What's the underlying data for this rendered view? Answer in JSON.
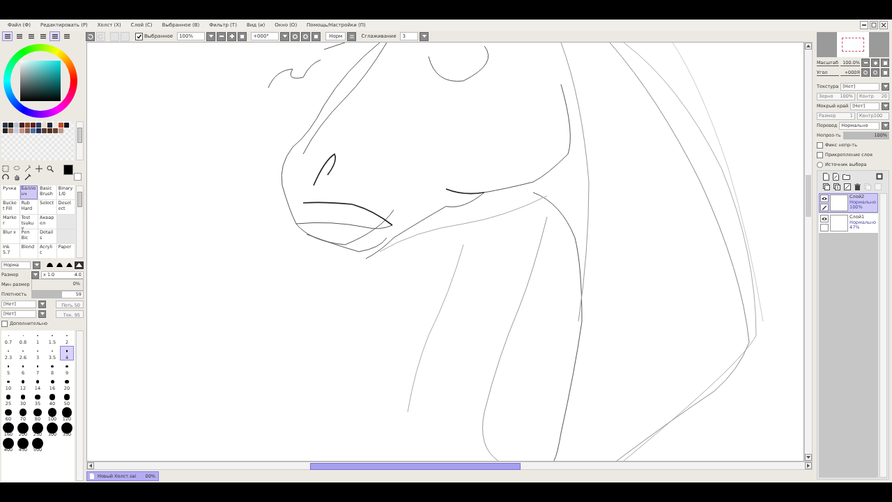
{
  "menu": [
    "Файл (Ф)",
    "Редактировать (Р)",
    "Холст (Х)",
    "Слой (С)",
    "Выбранное (В)",
    "Фильтр (Т)",
    "Вид (и)",
    "Окно (О)",
    "Помощь/Настройки (П)"
  ],
  "panel_toggles": [
    {
      "selected": true
    },
    {
      "selected": false
    },
    {
      "selected": false
    },
    {
      "selected": false
    },
    {
      "selected": true
    },
    {
      "selected": false
    }
  ],
  "toolbar": {
    "selection": {
      "label": "Выбранное",
      "checked": true
    },
    "zoom": "100%",
    "angle": "+000°",
    "mode_button": "Норм",
    "smoothing_label": "Сглаживание",
    "smoothing": "3"
  },
  "palette": [
    {
      "color": "#2a3440"
    },
    {
      "color": "#1c1a1c"
    },
    {
      "color": "#b8c2cc"
    },
    {
      "color": "#4a1c1c"
    },
    {
      "color": "#8a4020"
    },
    {
      "color": "#5a1c1c"
    },
    {
      "color": "#223a66"
    },
    {
      "color": "#f2dcc8"
    },
    {
      "color": "#1c2638"
    },
    {
      "color": "#f2e6dc"
    },
    {
      "color": "#c04a2a"
    },
    {
      "color": "#14141c"
    },
    {
      "color": "#2a2020"
    },
    {
      "color": "#a08070"
    },
    {
      "color": "#c8d0e0"
    },
    {
      "color": "#c09080"
    },
    {
      "color": "#8a6050"
    },
    {
      "color": "#4a6a9a"
    },
    {
      "color": "#1c2e5a"
    },
    {
      "color": "#5a3a2a"
    },
    {
      "color": "#4a3020"
    },
    {
      "color": "#6a4030"
    },
    {
      "color": "#c09888"
    }
  ],
  "tools": [
    {
      "label": "Ручка",
      "selected": false,
      "kind": "tool"
    },
    {
      "label": "Баллонч",
      "selected": true,
      "kind": "tool"
    },
    {
      "label": "Basic Brush",
      "selected": false,
      "kind": "tool"
    },
    {
      "label": "Binary 1/0",
      "selected": false,
      "kind": "tool"
    },
    {
      "label": "Bucket Fill",
      "selected": false,
      "kind": "tool"
    },
    {
      "label": "Rub Hard",
      "selected": false,
      "kind": "tool"
    },
    {
      "label": "Select",
      "selected": false,
      "kind": "tool"
    },
    {
      "label": "Deselect",
      "selected": false,
      "kind": "tool"
    },
    {
      "label": "Marker",
      "selected": false,
      "kind": "tool"
    },
    {
      "label": "Test tsukuy",
      "selected": false,
      "kind": "tool"
    },
    {
      "label": "Акварел",
      "selected": false,
      "kind": "tool"
    },
    {
      "kind": "empty"
    },
    {
      "label": "Blur x",
      "selected": false,
      "kind": "tool"
    },
    {
      "label": "Pen Bic",
      "selected": false,
      "kind": "tool"
    },
    {
      "label": "Details",
      "selected": false,
      "kind": "tool"
    },
    {
      "kind": "empty"
    },
    {
      "label": "Ink 5.7",
      "selected": false,
      "kind": "tool"
    },
    {
      "label": "Blend",
      "selected": false,
      "kind": "tool"
    },
    {
      "label": "Acrylic",
      "selected": false,
      "kind": "tool"
    },
    {
      "label": "Paper",
      "selected": false,
      "kind": "tool"
    }
  ],
  "brush": {
    "mode": "Норма",
    "tip_shapes": [
      {
        "selected": false
      },
      {
        "selected": false
      },
      {
        "selected": false
      },
      {
        "selected": true
      }
    ],
    "size_label": "Размер",
    "size_multiplier": "x 1.0",
    "size": "4.0",
    "min_size_label": "Мин размер",
    "min_size": "0%",
    "density_label": "Плотность",
    "density": {
      "value": "59",
      "level": 0.59
    },
    "texture_1": "[Нет]",
    "texture_1_param": "Поть 50",
    "texture_2": "[Нет]",
    "texture_2_param": "Тек. 95",
    "advanced": {
      "label": "Дополнительно",
      "checked": false
    }
  },
  "brush_sizes": [
    {
      "label": "0.7",
      "selected": false
    },
    {
      "label": "0.8",
      "selected": false
    },
    {
      "label": "1",
      "selected": false
    },
    {
      "label": "1.5",
      "selected": false
    },
    {
      "label": "2",
      "selected": false
    },
    {
      "label": "2.3",
      "selected": false
    },
    {
      "label": "2.6",
      "selected": false
    },
    {
      "label": "3",
      "selected": false
    },
    {
      "label": "3.5",
      "selected": false
    },
    {
      "label": "4",
      "selected": true
    },
    {
      "label": "5",
      "selected": false
    },
    {
      "label": "6",
      "selected": false
    },
    {
      "label": "7",
      "selected": false
    },
    {
      "label": "8",
      "selected": false
    },
    {
      "label": "9",
      "selected": false
    },
    {
      "label": "10",
      "selected": false
    },
    {
      "label": "12",
      "selected": false
    },
    {
      "label": "14",
      "selected": false
    },
    {
      "label": "16",
      "selected": false
    },
    {
      "label": "20",
      "selected": false
    },
    {
      "label": "25",
      "selected": false
    },
    {
      "label": "30",
      "selected": false
    },
    {
      "label": "35",
      "selected": false
    },
    {
      "label": "40",
      "selected": false
    },
    {
      "label": "50",
      "selected": false
    },
    {
      "label": "60",
      "selected": false
    },
    {
      "label": "70",
      "selected": false
    },
    {
      "label": "80",
      "selected": false
    },
    {
      "label": "100",
      "selected": false
    },
    {
      "label": "120",
      "selected": false
    },
    {
      "label": "160",
      "selected": false
    },
    {
      "label": "200",
      "selected": false
    },
    {
      "label": "250",
      "selected": false
    },
    {
      "label": "300",
      "selected": false
    },
    {
      "label": "350",
      "selected": false
    },
    {
      "label": "400",
      "selected": false
    },
    {
      "label": "450",
      "selected": false
    },
    {
      "label": "500",
      "selected": false
    }
  ],
  "navigator": {
    "zoom_label": "Масштаб",
    "zoom": "100.0%",
    "angle_label": "Угол",
    "angle": "+000Я"
  },
  "layer_props": {
    "texture_label": "Текстура",
    "texture": "[Нет]",
    "grain_label": "Зерно",
    "grain": "100%",
    "contrast_label": "Контр",
    "contrast": "20",
    "wet_edge_label": "Мокрый край",
    "wet_edge": "[Нет]",
    "wet_size_label": "Размер",
    "wet_size": "1",
    "wet_contrast": "Контр100",
    "blend_label": "Перевод",
    "blend": "Нормально",
    "opacity_label": "Непроз-ть",
    "opacity": {
      "value": "100%",
      "level": 1
    },
    "checks": [
      {
        "label": "Фикс непр-ть",
        "checked": false,
        "kind": "checkbox"
      },
      {
        "label": "Прикрепление слоя",
        "checked": false,
        "kind": "checkbox"
      },
      {
        "label": "Источник выбора",
        "checked": false,
        "kind": "radio"
      }
    ]
  },
  "layers": [
    {
      "name": "Слой2",
      "mode": "Нормально",
      "opacity": "100%",
      "selected": true,
      "visible": true
    },
    {
      "name": "Слой1",
      "mode": "Нормально",
      "opacity": "47%",
      "selected": false,
      "visible": true
    }
  ],
  "status": {
    "file": "Новый Холст.sai",
    "zoom": "00%",
    "selected": true
  }
}
